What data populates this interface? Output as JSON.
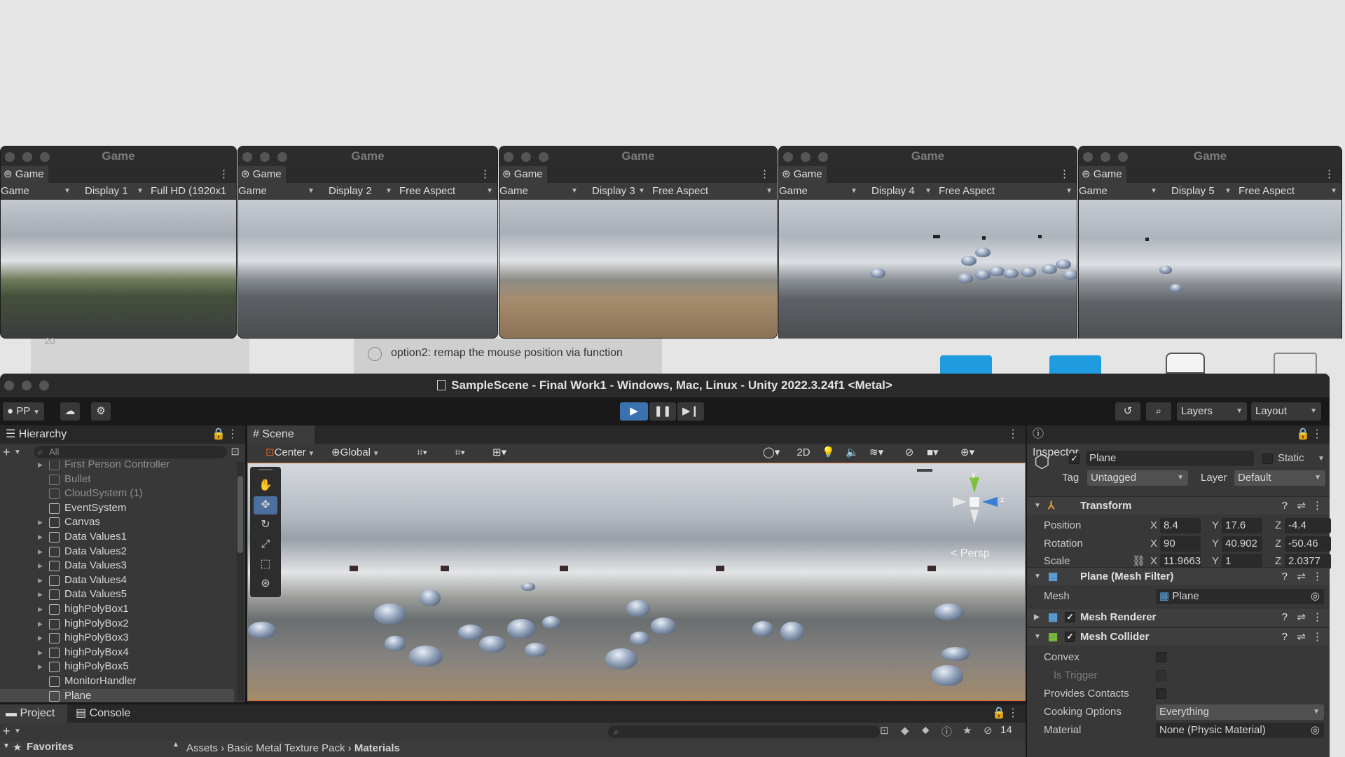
{
  "game_windows": [
    {
      "title": "Game",
      "tab": "Game",
      "mode": "Game",
      "display": "Display 1",
      "aspect": "Full HD (1920x1"
    },
    {
      "title": "Game",
      "tab": "Game",
      "mode": "Game",
      "display": "Display 2",
      "aspect": "Free Aspect"
    },
    {
      "title": "Game",
      "tab": "Game",
      "mode": "Game",
      "display": "Display 3",
      "aspect": "Free Aspect"
    },
    {
      "title": "Game",
      "tab": "Game",
      "mode": "Game",
      "display": "Display 4",
      "aspect": "Free Aspect"
    },
    {
      "title": "Game",
      "tab": "Game",
      "mode": "Game",
      "display": "Display 5",
      "aspect": "Free Aspect"
    }
  ],
  "background": {
    "page_number": "20",
    "option_text": "option2: remap the mouse position via function"
  },
  "unity": {
    "title": "SampleScene - Final Work1 - Windows, Mac, Linux - Unity 2022.3.24f1 <Metal>",
    "toolbar": {
      "account": "PP",
      "layers": "Layers",
      "layout": "Layout"
    },
    "hierarchy": {
      "tab": "Hierarchy",
      "search_placeholder": "All",
      "items": [
        {
          "name": "First Person Controller",
          "dim": true,
          "arrow": true
        },
        {
          "name": "Bullet",
          "dim": true,
          "arrow": false
        },
        {
          "name": "CloudSystem (1)",
          "dim": true,
          "arrow": false
        },
        {
          "name": "EventSystem",
          "dim": false,
          "arrow": false
        },
        {
          "name": "Canvas",
          "dim": false,
          "arrow": true
        },
        {
          "name": "Data Values1",
          "dim": false,
          "arrow": true
        },
        {
          "name": "Data Values2",
          "dim": false,
          "arrow": true
        },
        {
          "name": "Data Values3",
          "dim": false,
          "arrow": true
        },
        {
          "name": "Data Values4",
          "dim": false,
          "arrow": true
        },
        {
          "name": "Data Values5",
          "dim": false,
          "arrow": true
        },
        {
          "name": "highPolyBox1",
          "dim": false,
          "arrow": true
        },
        {
          "name": "highPolyBox2",
          "dim": false,
          "arrow": true
        },
        {
          "name": "highPolyBox3",
          "dim": false,
          "arrow": true
        },
        {
          "name": "highPolyBox4",
          "dim": false,
          "arrow": true
        },
        {
          "name": "highPolyBox5",
          "dim": false,
          "arrow": true
        },
        {
          "name": "MonitorHandler",
          "dim": false,
          "arrow": false
        },
        {
          "name": "Plane",
          "dim": false,
          "arrow": false,
          "selected": true
        }
      ]
    },
    "scene": {
      "tab": "Scene",
      "pivot": "Center",
      "space": "Global",
      "mode_2d": "2D",
      "persp": "< Persp",
      "gizmo": {
        "y": "y",
        "z": "z"
      }
    },
    "project": {
      "tab_project": "Project",
      "tab_console": "Console",
      "favorites": "Favorites",
      "breadcrumb": [
        "Assets",
        "Basic Metal Texture Pack",
        "Materials"
      ],
      "hidden_count": "14"
    },
    "inspector": {
      "tab": "Inspector",
      "object_name": "Plane",
      "static_label": "Static",
      "tag_label": "Tag",
      "tag_value": "Untagged",
      "layer_label": "Layer",
      "layer_value": "Default",
      "transform": {
        "title": "Transform",
        "position": {
          "label": "Position",
          "x": "8.4",
          "y": "17.6",
          "z": "-4.4"
        },
        "rotation": {
          "label": "Rotation",
          "x": "90",
          "y": "40.902",
          "z": "-50.46"
        },
        "scale": {
          "label": "Scale",
          "x": "11.9663",
          "y": "1",
          "z": "2.0377"
        }
      },
      "mesh_filter": {
        "title": "Plane (Mesh Filter)",
        "mesh_label": "Mesh",
        "mesh_value": "Plane"
      },
      "mesh_renderer": {
        "title": "Mesh Renderer"
      },
      "mesh_collider": {
        "title": "Mesh Collider",
        "convex": "Convex",
        "is_trigger": "Is Trigger",
        "provides_contacts": "Provides Contacts",
        "cooking_label": "Cooking Options",
        "cooking_value": "Everything",
        "material_label": "Material",
        "material_value": "None (Physic Material)"
      }
    }
  },
  "colors": {
    "play_active": "#3a72b0",
    "scene_border": "#d66a2b"
  }
}
